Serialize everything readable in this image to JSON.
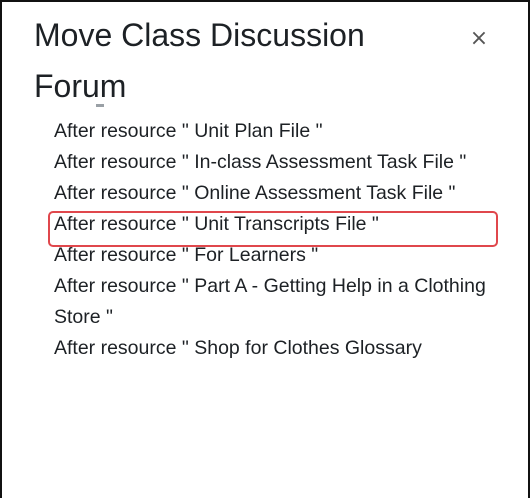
{
  "dialog": {
    "title": "Move Class Discussion Forum",
    "close_icon": "close-icon",
    "close_glyph": "×"
  },
  "positions": [
    {
      "label": "After resource \" Unit Plan File \""
    },
    {
      "label": "After resource \" In-class Assessment Task File \""
    },
    {
      "label": "After resource \" Online Assessment Task File \""
    },
    {
      "label": "After resource \" Unit Transcripts File \"",
      "highlighted": true
    },
    {
      "label": "After resource \" For Learners \""
    },
    {
      "label": "After resource \" Part A - Getting Help in a Clothing Store \""
    },
    {
      "label": "After resource \" Shop for Clothes Glossary"
    }
  ],
  "colors": {
    "highlight_border": "#e0474c",
    "text": "#1d2125",
    "dialog_border": "#111111"
  }
}
